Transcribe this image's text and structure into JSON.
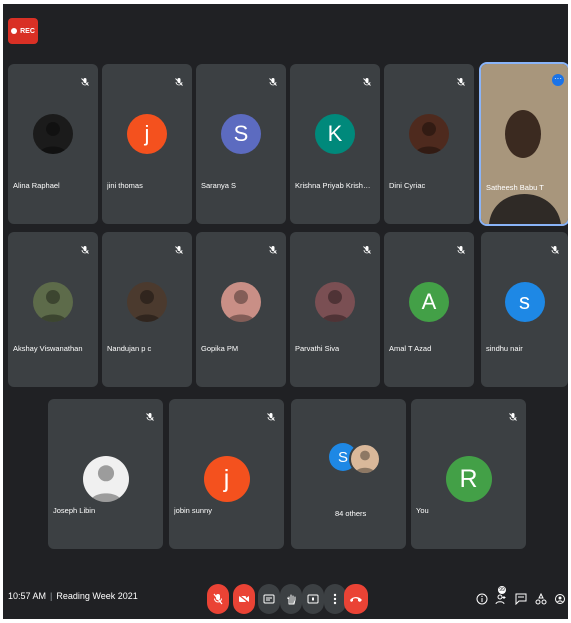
{
  "recording": {
    "label": "REC"
  },
  "participants": [
    {
      "name": "Alina Raphael",
      "avatar_color": "#1b1b1b"
    },
    {
      "name": "jini thomas",
      "initial": "j",
      "avatar_color": "#f4511e"
    },
    {
      "name": "Saranya S",
      "initial": "S",
      "avatar_color": "#5c6bc0"
    },
    {
      "name": "Krishna Priyab Krishna Pri...",
      "initial": "K",
      "avatar_color": "#00897b"
    },
    {
      "name": "Dini Cyriac",
      "avatar_color": "#4e2a1e"
    },
    {
      "name": "Satheesh Babu T",
      "avatar_color": "#6f5a44"
    },
    {
      "name": "Akshay Viswanathan",
      "avatar_color": "#5d6b4a"
    },
    {
      "name": "Nandujan p c",
      "avatar_color": "#4b3a2e"
    },
    {
      "name": "Gopika PM",
      "avatar_color": "#c98f86"
    },
    {
      "name": "Parvathi Siva",
      "avatar_color": "#7a4f53"
    },
    {
      "name": "Amal T Azad",
      "initial": "A",
      "avatar_color": "#43a047"
    },
    {
      "name": "sindhu nair",
      "initial": "s",
      "avatar_color": "#1e88e5"
    },
    {
      "name": "Joseph Libin",
      "avatar_color": "#f0f0f0"
    },
    {
      "name": "jobin sunny",
      "initial": "j",
      "avatar_color": "#f4511e"
    },
    {
      "name": "You",
      "initial": "R",
      "avatar_color": "#43a047"
    }
  ],
  "others": {
    "label": "84 others",
    "initial": "S",
    "avatar_color": "#1e88e5"
  },
  "meeting": {
    "time": "10:57 AM",
    "separator": "|",
    "title": "Reading Week 2021"
  },
  "controls": {
    "mic_icon": "mic-off-icon",
    "camera_icon": "camera-off-icon",
    "captions_icon": "captions-icon",
    "hand_icon": "raise-hand-icon",
    "present_icon": "present-icon",
    "more_icon": "more-options-icon",
    "end_icon": "end-call-icon"
  },
  "right_controls": {
    "info_icon": "info-icon",
    "people_icon": "people-icon",
    "people_badge": "99",
    "chat_icon": "chat-icon",
    "activities_icon": "activities-icon",
    "host_icon": "host-controls-icon"
  }
}
